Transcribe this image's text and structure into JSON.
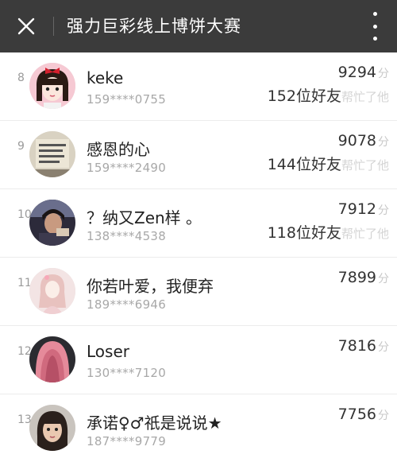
{
  "header": {
    "title": "强力巨彩线上博饼大赛",
    "close_icon": "close-icon",
    "more_icon": "more-vertical-icon",
    "background": "#3b3b3b"
  },
  "score_unit": "分",
  "entries": [
    {
      "rank": "8",
      "name": "keke",
      "phone": "159****0755",
      "score": "9294",
      "friends_count": "152位好友",
      "friends_help": "帮忙了他"
    },
    {
      "rank": "9",
      "name": "感恩的心",
      "phone": "159****2490",
      "score": "9078",
      "friends_count": "144位好友",
      "friends_help": "帮忙了他"
    },
    {
      "rank": "10",
      "name": "？纳又Zen样 。",
      "phone": "138****4538",
      "score": "7912",
      "friends_count": "118位好友",
      "friends_help": "帮忙了他"
    },
    {
      "rank": "11",
      "name": "你若叶爱，我便弃",
      "phone": "189****6946",
      "score": "7899"
    },
    {
      "rank": "12",
      "name": "Loser",
      "phone": "130****7120",
      "score": "7816"
    },
    {
      "rank": "13",
      "name": "承诺♀♂祇是说说★",
      "phone": "187****9779",
      "score": "7756"
    }
  ]
}
